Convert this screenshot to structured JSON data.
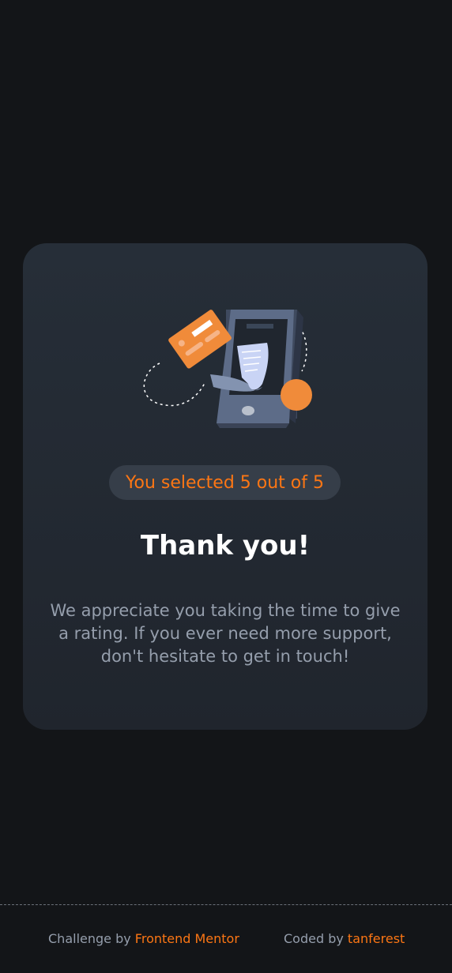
{
  "card": {
    "selected_text": "You selected 5 out of 5",
    "title": "Thank you!",
    "message": "We appreciate you taking the time to give a rating. If you ever need more support, don't hesitate to get in touch!",
    "illustration_icon": "payment-phone-illustration-icon"
  },
  "footer": {
    "challenge_prefix": "Challenge by",
    "challenge_link": "Frontend Mentor",
    "coded_prefix": "Coded by",
    "coded_link": "tanferest"
  },
  "colors": {
    "background": "#131518",
    "card": "#232a34",
    "accent": "#fc7614",
    "text_muted": "#959eac",
    "badge_bg": "#363e49"
  }
}
